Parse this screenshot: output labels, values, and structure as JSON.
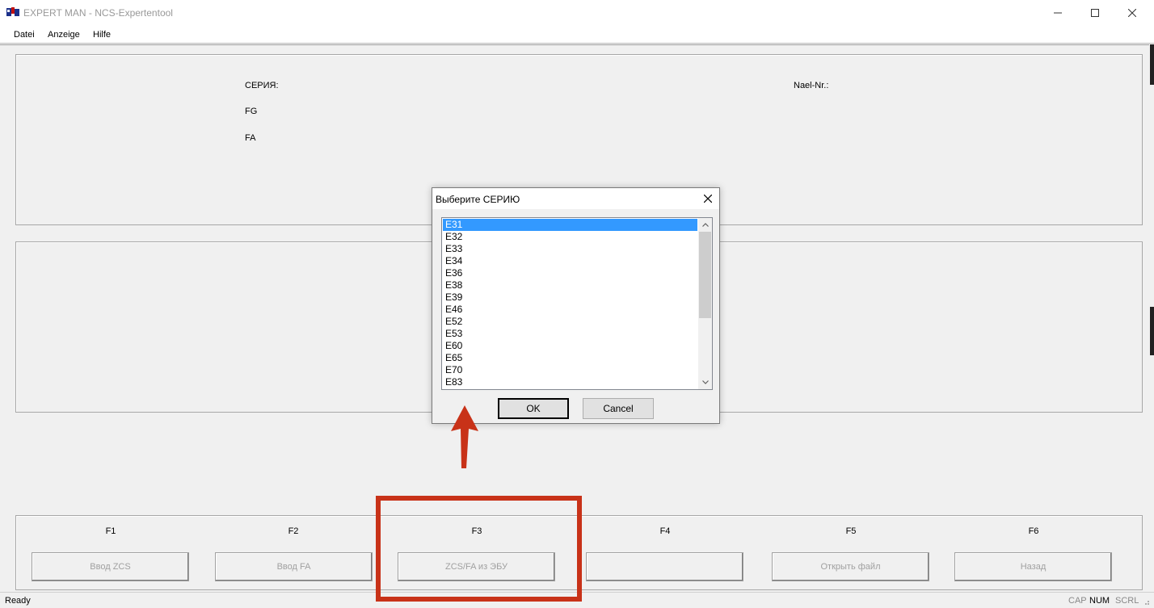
{
  "window": {
    "title": "EXPERT  MAN - NCS-Expertentool",
    "icon": "expert-man-app-icon"
  },
  "menu": [
    "Datei",
    "Anzeige",
    "Hilfe"
  ],
  "info_panel": {
    "series_label": "СЕРИЯ:",
    "fg_label": "FG",
    "fa_label": "FA",
    "nael_label": "Nael-Nr.:"
  },
  "function_keys": [
    {
      "key": "F1",
      "label": "Ввод ZCS"
    },
    {
      "key": "F2",
      "label": "Ввод FA"
    },
    {
      "key": "F3",
      "label": "ZCS/FA из ЭБУ"
    },
    {
      "key": "F4",
      "label": ""
    },
    {
      "key": "F5",
      "label": "Открыть файл"
    },
    {
      "key": "F6",
      "label": "Назад"
    }
  ],
  "statusbar": {
    "text": "Ready",
    "indicators": [
      "CAP",
      "NUM",
      "SCRL"
    ],
    "active_indicator": "NUM"
  },
  "dialog": {
    "title": "Выберите СЕРИЮ",
    "items": [
      "E31",
      "E32",
      "E33",
      "E34",
      "E36",
      "E38",
      "E39",
      "E46",
      "E52",
      "E53",
      "E60",
      "E65",
      "E70",
      "E83"
    ],
    "selected": "E31",
    "ok_label": "OK",
    "cancel_label": "Cancel"
  },
  "annotation": {
    "color": "#c83218"
  }
}
